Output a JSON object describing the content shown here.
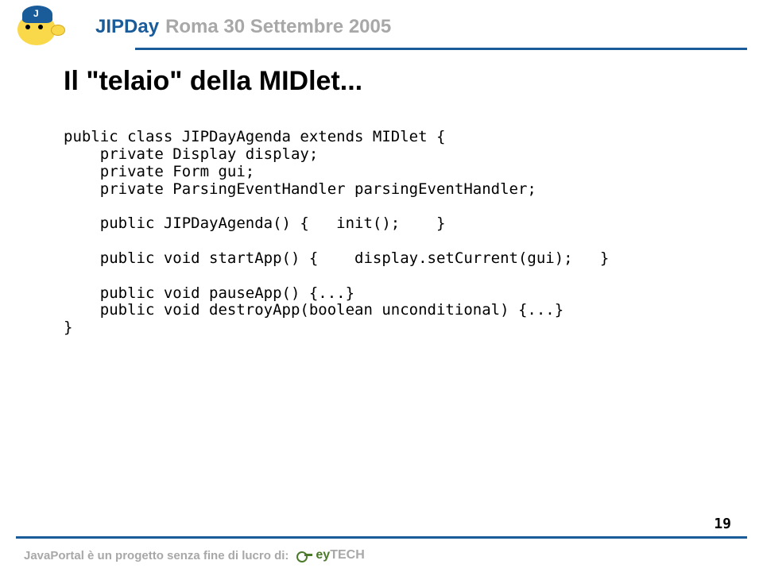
{
  "header": {
    "brand": "JIPDay",
    "event": "Roma 30 Settembre 2005"
  },
  "slide": {
    "title": "Il \"telaio\" della MIDlet...",
    "code": "public class JIPDayAgenda extends MIDlet {\n    private Display display;\n    private Form gui;\n    private ParsingEventHandler parsingEventHandler;\n\n    public JIPDayAgenda() {   init();    }\n\n    public void startApp() {    display.setCurrent(gui);   }\n\n    public void pauseApp() {...}\n    public void destroyApp(boolean unconditional) {...}\n}"
  },
  "footer": {
    "text": "JavaPortal è un progetto senza fine di lucro di:",
    "logo_prefix": "ey",
    "logo_suffix": "TECH"
  },
  "page_number": "19"
}
